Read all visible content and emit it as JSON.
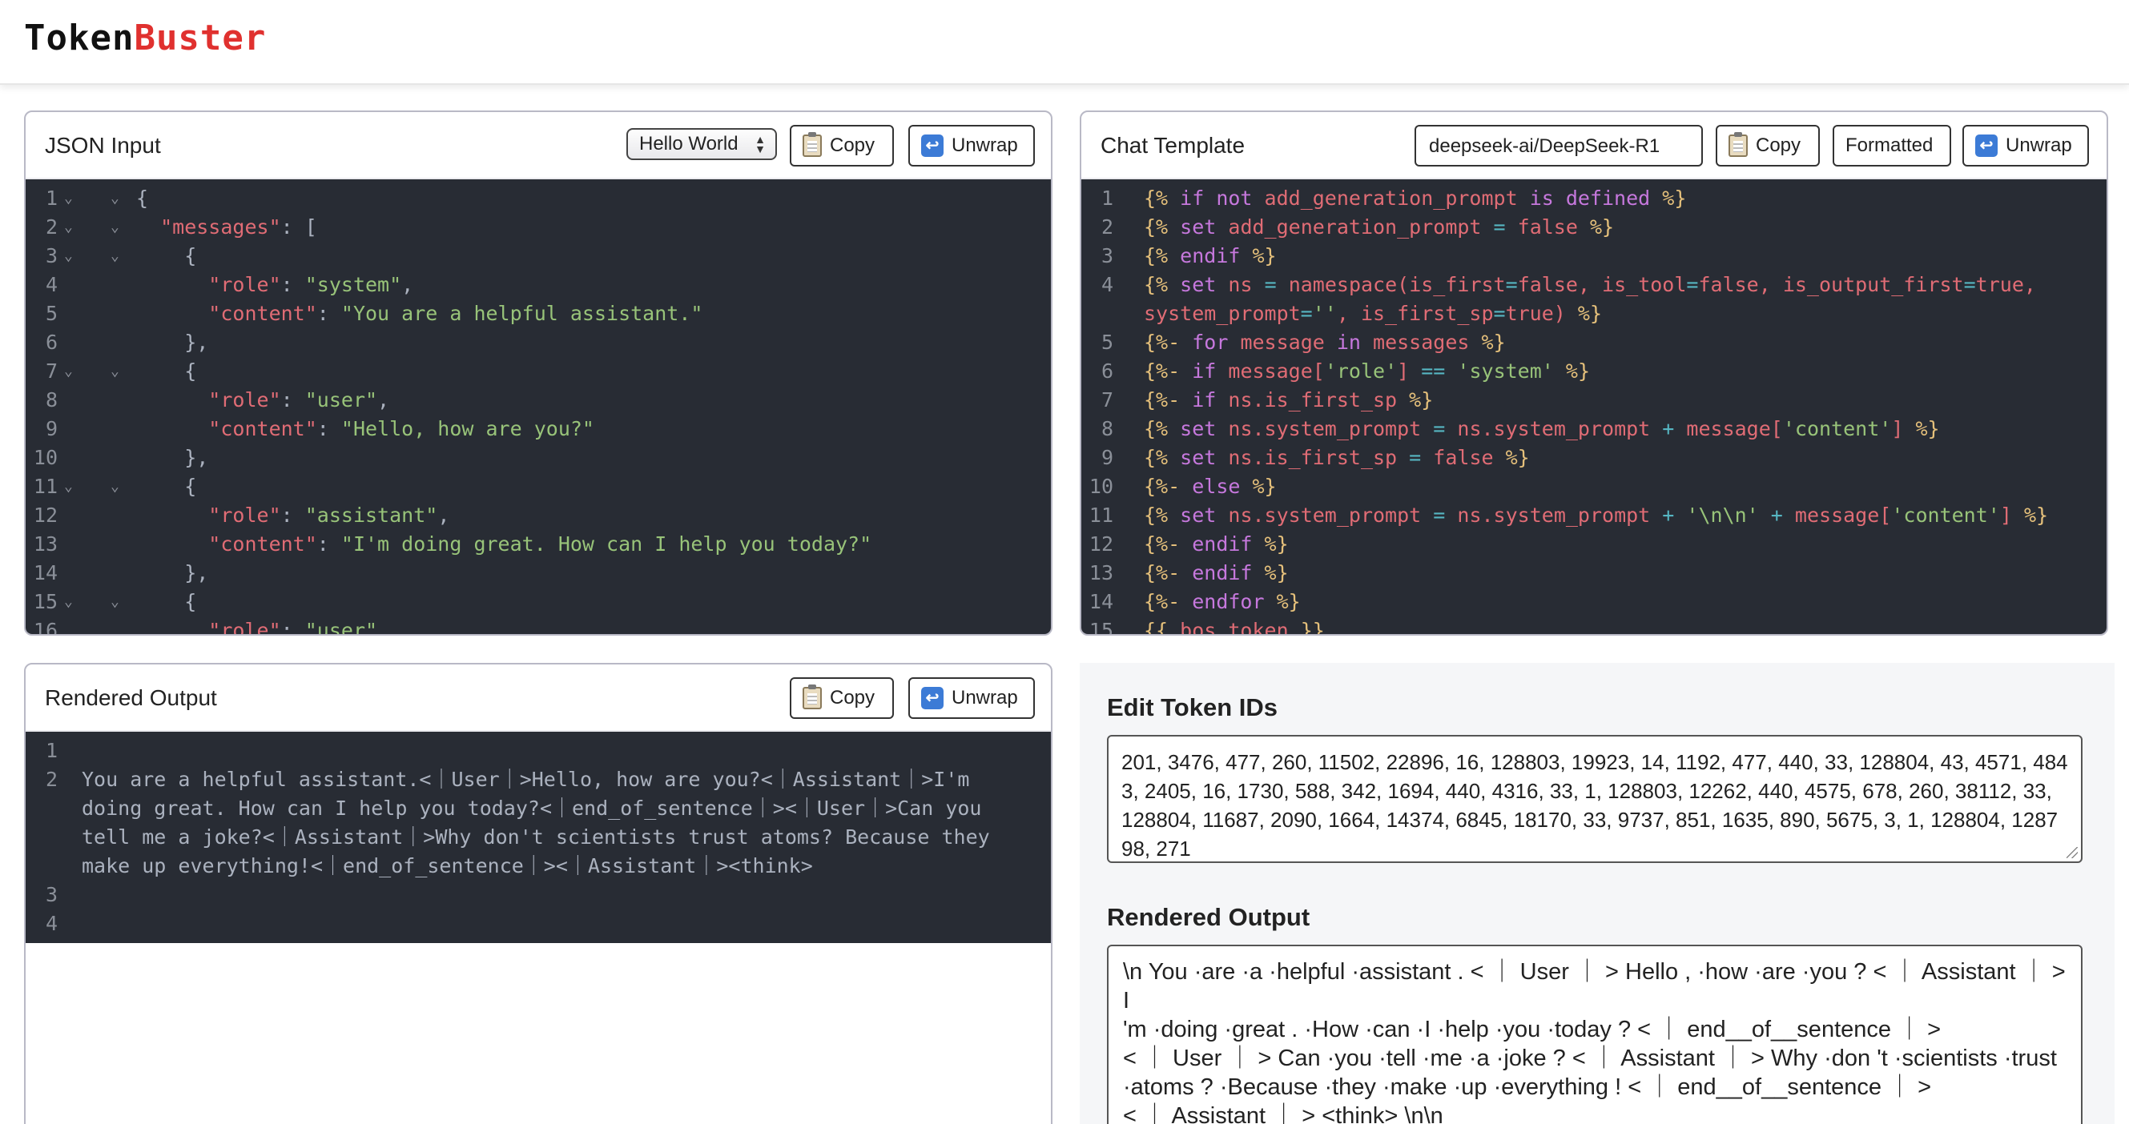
{
  "app": {
    "logo_part1": "Token",
    "logo_part2": "Buster"
  },
  "json_input": {
    "title": "JSON Input",
    "select_value": "Hello World",
    "copy_label": "Copy",
    "unwrap_label": "Unwrap",
    "lines": [
      "{",
      "  \"messages\": [",
      "    {",
      "      \"role\": \"system\",",
      "      \"content\": \"You are a helpful assistant.\"",
      "    },",
      "    {",
      "      \"role\": \"user\",",
      "      \"content\": \"Hello, how are you?\"",
      "    },",
      "    {",
      "      \"role\": \"assistant\",",
      "      \"content\": \"I'm doing great. How can I help you today?\"",
      "    },",
      "    {",
      "      \"role\": \"user\""
    ]
  },
  "chat_template": {
    "title": "Chat Template",
    "model_value": "deepseek-ai/DeepSeek-R1",
    "copy_label": "Copy",
    "formatted_label": "Formatted",
    "unwrap_label": "Unwrap"
  },
  "rendered_output_panel": {
    "title": "Rendered Output",
    "copy_label": "Copy",
    "unwrap_label": "Unwrap",
    "line2": [
      "You are a helpful assistant.<｜User｜>Hello, how are you?<｜Assistant｜>I'm",
      "doing great. How can I help you today?<｜end_of_sentence｜><｜User｜>Can you",
      "tell me a joke?<｜Assistant｜>Why don't scientists trust atoms? Because they",
      "make up everything!<｜end_of_sentence｜><｜Assistant｜><think>"
    ]
  },
  "edit_token_ids": {
    "title": "Edit Token IDs",
    "value": "201, 3476, 477, 260, 11502, 22896, 16, 128803, 19923, 14, 1192, 477, 440, 33, 128804, 43, 4571, 4843, 2405, 16, 1730, 588, 342, 1694, 440, 4316, 33, 1, 128803, 12262, 440, 4575, 678, 260, 38112, 33, 128804, 11687, 2090, 1664, 14374, 6845, 18170, 33, 9737, 851, 1635, 890, 5675, 3, 1, 128804, 128798, 271"
  },
  "rendered_output_tokens": {
    "title": "Rendered Output",
    "lines": [
      "\\n You ·are ·a ·helpful ·assistant . < ｜ User ｜ > Hello , ·how ·are ·you ? < ｜ Assistant ｜ > I",
      "'m ·doing ·great . ·How ·can ·I ·help ·you ·today ? < ｜ end__of__sentence ｜ >",
      "< ｜ User ｜ > Can ·you ·tell ·me ·a ·joke ? < ｜ Assistant ｜ > Why ·don 't ·scientists ·trust",
      "·atoms ? ·Because ·they ·make ·up ·everything ! < ｜ end__of__sentence ｜ >",
      "< ｜ Assistant ｜ > <think> \\n\\n"
    ]
  }
}
